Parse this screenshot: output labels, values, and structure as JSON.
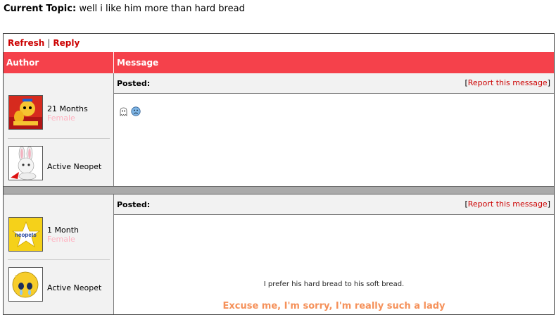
{
  "topic": {
    "label": "Current Topic:",
    "title": "well i like him more than hard bread"
  },
  "toolbar": {
    "refresh": "Refresh",
    "reply": "Reply",
    "separator": "|"
  },
  "columns": {
    "author": "Author",
    "message": "Message"
  },
  "posts": [
    {
      "posted_label": "Posted:",
      "report": {
        "open": "[",
        "label": "Report this message",
        "close": "]"
      },
      "author": {
        "age": "21 Months",
        "gender": "Female",
        "pet_status": "Active Neopet",
        "avatar_icon": "yellow-creature-avatar-icon",
        "pet_icon": "white-bunny-pet-icon"
      },
      "message": {
        "emotes": [
          "ghost-emote-icon",
          "sad-face-emote-icon"
        ]
      }
    },
    {
      "posted_label": "Posted:",
      "report": {
        "open": "[",
        "label": "Report this message",
        "close": "]"
      },
      "author": {
        "age": "1 Month",
        "gender": "Female",
        "pet_status": "Active Neopet",
        "avatar_icon": "neopets-star-avatar-icon",
        "pet_icon": "crying-yellow-pet-icon"
      },
      "message": {
        "text": "I prefer his hard bread to his soft bread.",
        "quote": "Excuse me, I'm sorry, I'm really such a lady"
      }
    }
  ],
  "colors": {
    "header_bg": "#f5414b",
    "link": "#cc0000",
    "gender": "#ffb3c1",
    "quote": "#f5915a"
  }
}
